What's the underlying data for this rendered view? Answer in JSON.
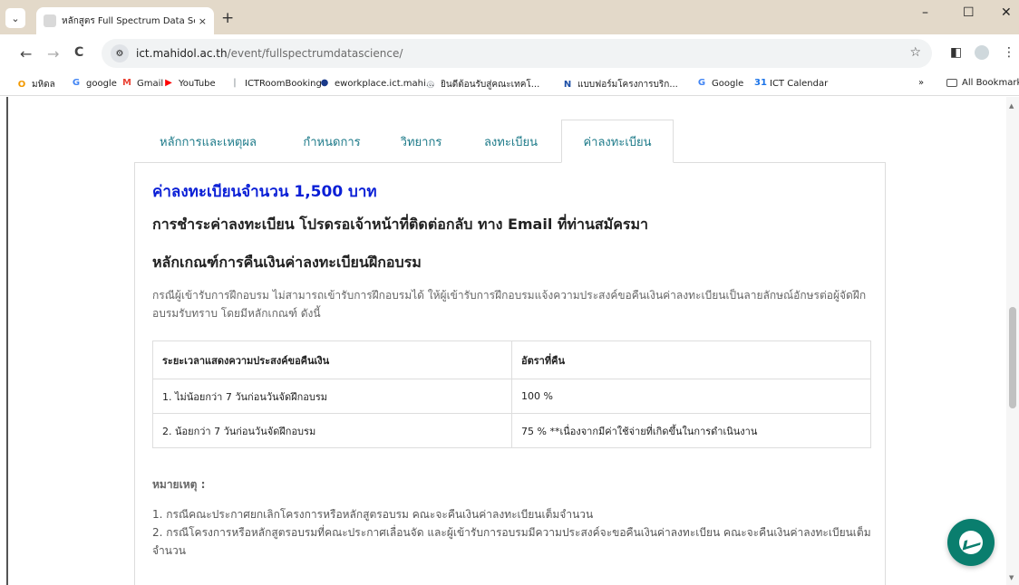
{
  "browser": {
    "tab": {
      "title": "หลักสูตร Full Spectrum Data Scie",
      "close_icon": "×"
    },
    "new_tab_icon": "+",
    "window_controls": {
      "minimize": "–",
      "maximize": "☐",
      "close": "✕"
    },
    "toolbar": {
      "back_icon": "←",
      "forward_icon": "→",
      "reload_icon": "C",
      "url_host": "ict.mahidol.ac.th",
      "url_path": "/event/fullspectrumdatascience/",
      "star_icon": "☆"
    },
    "bookmarks": [
      {
        "label": "มหิดล",
        "icon": "O",
        "color": "#f29900"
      },
      {
        "label": "google",
        "icon": "G",
        "color": "#4285f4"
      },
      {
        "label": "Gmail",
        "icon": "M",
        "color": "#ea4335"
      },
      {
        "label": "YouTube",
        "icon": "▶",
        "color": "#ff0000"
      },
      {
        "label": "ICTRoomBooking",
        "icon": "|",
        "color": "#9aa0a6"
      },
      {
        "label": "eworkplace.ict.mahi...",
        "icon": "●",
        "color": "#1a3a8a"
      },
      {
        "label": "ยินดีต้อนรับสู่คณะเทคโ...",
        "icon": "◎",
        "color": "#9aa0a6"
      },
      {
        "label": "แบบฟอร์มโครงการบริก...",
        "icon": "N",
        "color": "#1d4fa6"
      },
      {
        "label": "Google",
        "icon": "G",
        "color": "#4285f4"
      },
      {
        "label": "ICT Calendar",
        "icon": "31",
        "color": "#1a73e8"
      }
    ],
    "bookmarks_more": "»",
    "all_bookmarks": "All Bookmarks"
  },
  "content_tabs": [
    {
      "label": "หลักการและเหตุผล"
    },
    {
      "label": "กำหนดการ"
    },
    {
      "label": "วิทยากร"
    },
    {
      "label": "ลงทะเบียน"
    },
    {
      "label": "ค่าลงทะเบียน"
    }
  ],
  "panel": {
    "fee": "ค่าลงทะเบียนจำนวน 1,500 บาท",
    "payment_heading": "การชำระค่าลงทะเบียน โปรดรอเจ้าหน้าที่ติดต่อกลับ ทาง Email ที่ท่านสมัครมา",
    "refund_heading": "หลักเกณฑ์การคืนเงินค่าลงทะเบียนฝึกอบรม",
    "refund_paragraph": "กรณีผู้เข้ารับการฝึกอบรม ไม่สามารถเข้ารับการฝึกอบรมได้ ให้ผู้เข้ารับการฝึกอบรมแจ้งความประสงค์ขอคืนเงินค่าลงทะเบียนเป็นลายลักษณ์อักษรต่อผู้จัดฝึกอบรมรับทราบ โดยมีหลักเกณฑ์ ดังนี้",
    "table": {
      "headers": [
        "ระยะเวลาแสดงความประสงค์ขอคืนเงิน",
        "อัตราที่คืน"
      ],
      "rows": [
        [
          "1. ไม่น้อยกว่า 7 วันก่อนวันจัดฝึกอบรม",
          "100 %"
        ],
        [
          "2. น้อยกว่า 7 วันก่อนวันจัดฝึกอบรม",
          "75 % **เนื่องจากมีค่าใช้จ่ายที่เกิดขึ้นในการดำเนินงาน"
        ]
      ]
    },
    "note_title": "หมายเหตุ :",
    "notes": [
      "1. กรณีคณะประกาศยกเลิกโครงการหรือหลักสูตรอบรม คณะจะคืนเงินค่าลงทะเบียนเต็มจำนวน",
      "2. กรณีโครงการหรือหลักสูตรอบรมที่คณะประกาศเลื่อนจัด และผู้เข้ารับการอบรมมีความประสงค์จะขอคืนเงินค่าลงทะเบียน คณะจะคืนเงินค่าลงทะเบียนเต็มจำนวน"
    ]
  }
}
